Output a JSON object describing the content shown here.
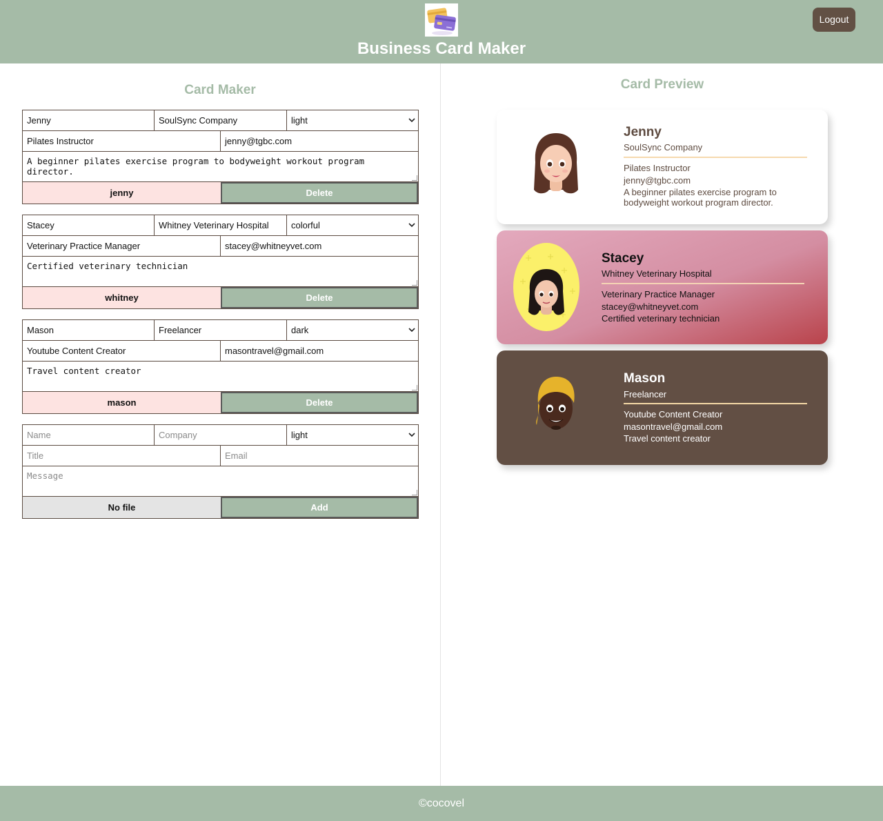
{
  "header": {
    "title": "Business Card Maker",
    "logout_label": "Logout",
    "logo_icon": "credit-cards-icon"
  },
  "maker": {
    "title": "Card Maker",
    "cards": [
      {
        "name": "Jenny",
        "company": "SoulSync Company",
        "theme": "light",
        "title": "Pilates Instructor",
        "email": "jenny@tgbc.com",
        "message": "A beginner pilates exercise program to bodyweight workout program director.",
        "file_label": "jenny",
        "action_label": "Delete"
      },
      {
        "name": "Stacey",
        "company": "Whitney Veterinary Hospital",
        "theme": "colorful",
        "title": "Veterinary Practice Manager",
        "email": "stacey@whitneyvet.com",
        "message": "Certified veterinary technician",
        "file_label": "whitney",
        "action_label": "Delete"
      },
      {
        "name": "Mason",
        "company": "Freelancer",
        "theme": "dark",
        "title": "Youtube Content Creator",
        "email": "masontravel@gmail.com",
        "message": "Travel content creator",
        "file_label": "mason",
        "action_label": "Delete"
      }
    ],
    "new_card": {
      "name_placeholder": "Name",
      "company_placeholder": "Company",
      "theme": "light",
      "title_placeholder": "Title",
      "email_placeholder": "Email",
      "message_placeholder": "Message",
      "file_label": "No file",
      "action_label": "Add"
    }
  },
  "preview": {
    "title": "Card Preview",
    "cards": [
      {
        "name": "Jenny",
        "company": "SoulSync Company",
        "title": "Pilates Instructor",
        "email": "jenny@tgbc.com",
        "message": "A beginner pilates exercise program to bodyweight workout program director.",
        "theme": "light",
        "avatar_icon": "memoji-woman-brown-hair-avatar"
      },
      {
        "name": "Stacey",
        "company": "Whitney Veterinary Hospital",
        "title": "Veterinary Practice Manager",
        "email": "stacey@whitneyvet.com",
        "message": "Certified veterinary technician",
        "theme": "colorful",
        "avatar_icon": "memoji-woman-dark-hair-avatar"
      },
      {
        "name": "Mason",
        "company": "Freelancer",
        "title": "Youtube Content Creator",
        "email": "masontravel@gmail.com",
        "message": "Travel content creator",
        "theme": "dark",
        "avatar_icon": "memoji-man-yellow-beanie-avatar"
      }
    ]
  },
  "footer": {
    "text": "©cocovel"
  },
  "colors": {
    "sage": "#a5bba7",
    "brown": "#625044",
    "pink": "#fde3e1",
    "gray": "#e4e4e4"
  }
}
